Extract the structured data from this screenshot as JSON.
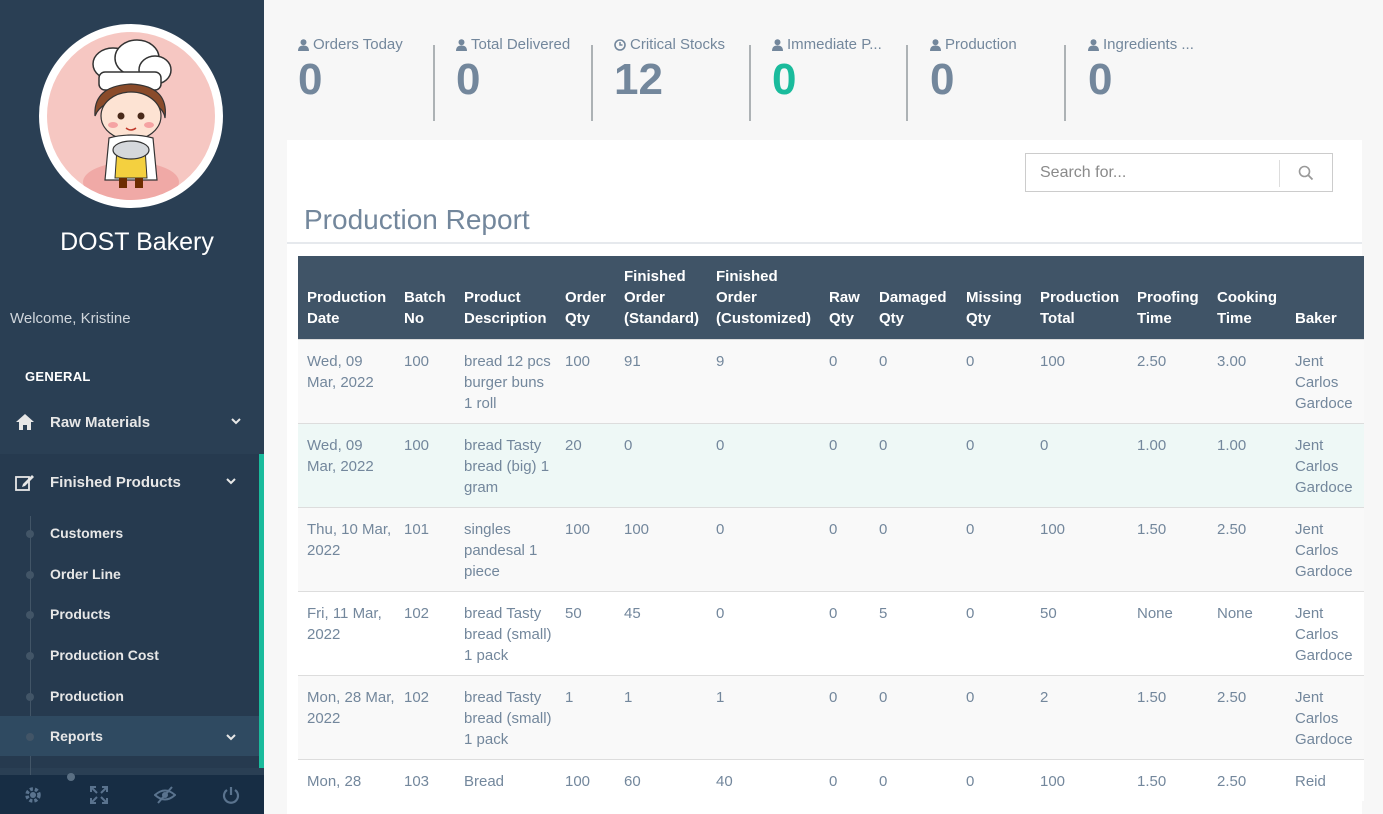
{
  "sidebar": {
    "brand": "DOST Bakery",
    "welcome": "Welcome, Kristine",
    "section": "GENERAL",
    "menu": {
      "raw_materials": "Raw Materials",
      "finished_products": "Finished Products"
    },
    "submenu": [
      "Customers",
      "Order Line",
      "Products",
      "Production Cost",
      "Production",
      "Reports"
    ],
    "footer_icons": [
      "settings-icon",
      "fullscreen-icon",
      "hide-icon",
      "power-icon"
    ]
  },
  "tiles": [
    {
      "label": "Orders Today",
      "count": "0",
      "icon": "user-icon"
    },
    {
      "label": "Total Delivered",
      "count": "0",
      "icon": "user-icon"
    },
    {
      "label": "Critical Stocks",
      "count": "12",
      "icon": "clock-icon"
    },
    {
      "label": "Immediate P...",
      "count": "0",
      "icon": "user-icon",
      "accent": "#1abb9c"
    },
    {
      "label": "Production",
      "count": "0",
      "icon": "user-icon"
    },
    {
      "label": "Ingredients ...",
      "count": "0",
      "icon": "user-icon"
    }
  ],
  "search": {
    "placeholder": "Search for..."
  },
  "report": {
    "title": "Production Report",
    "columns": [
      "Production Date",
      "Batch No",
      "Product Description",
      "Order Qty",
      "Finished Order (Standard)",
      "Finished Order (Customized)",
      "Raw Qty",
      "Damaged Qty",
      "Missing Qty",
      "Production Total",
      "Proofing Time",
      "Cooking Time",
      "Baker"
    ],
    "rows": [
      [
        "Wed, 09 Mar, 2022",
        "100",
        "bread 12 pcs burger buns 1 roll",
        "100",
        "91",
        "9",
        "0",
        "0",
        "0",
        "100",
        "2.50",
        "3.00",
        "Jent Carlos Gardoce"
      ],
      [
        "Wed, 09 Mar, 2022",
        "100",
        "bread Tasty bread (big) 1 gram",
        "20",
        "0",
        "0",
        "0",
        "0",
        "0",
        "0",
        "1.00",
        "1.00",
        "Jent Carlos Gardoce"
      ],
      [
        "Thu, 10 Mar, 2022",
        "101",
        "singles pandesal 1 piece",
        "100",
        "100",
        "0",
        "0",
        "0",
        "0",
        "100",
        "1.50",
        "2.50",
        "Jent Carlos Gardoce"
      ],
      [
        "Fri, 11 Mar, 2022",
        "102",
        "bread Tasty bread (small) 1 pack",
        "50",
        "45",
        "0",
        "0",
        "5",
        "0",
        "50",
        "None",
        "None",
        "Jent Carlos Gardoce"
      ],
      [
        "Mon, 28 Mar, 2022",
        "102",
        "bread Tasty bread (small) 1 pack",
        "1",
        "1",
        "1",
        "0",
        "0",
        "0",
        "2",
        "1.50",
        "2.50",
        "Jent Carlos Gardoce"
      ],
      [
        "Mon, 28",
        "103",
        "Bread",
        "100",
        "60",
        "40",
        "0",
        "0",
        "0",
        "100",
        "1.50",
        "2.50",
        "Reid"
      ]
    ]
  },
  "colors": {
    "sidebar": "#2a3f54",
    "accent": "#1abb9c",
    "table_header": "#405467"
  }
}
